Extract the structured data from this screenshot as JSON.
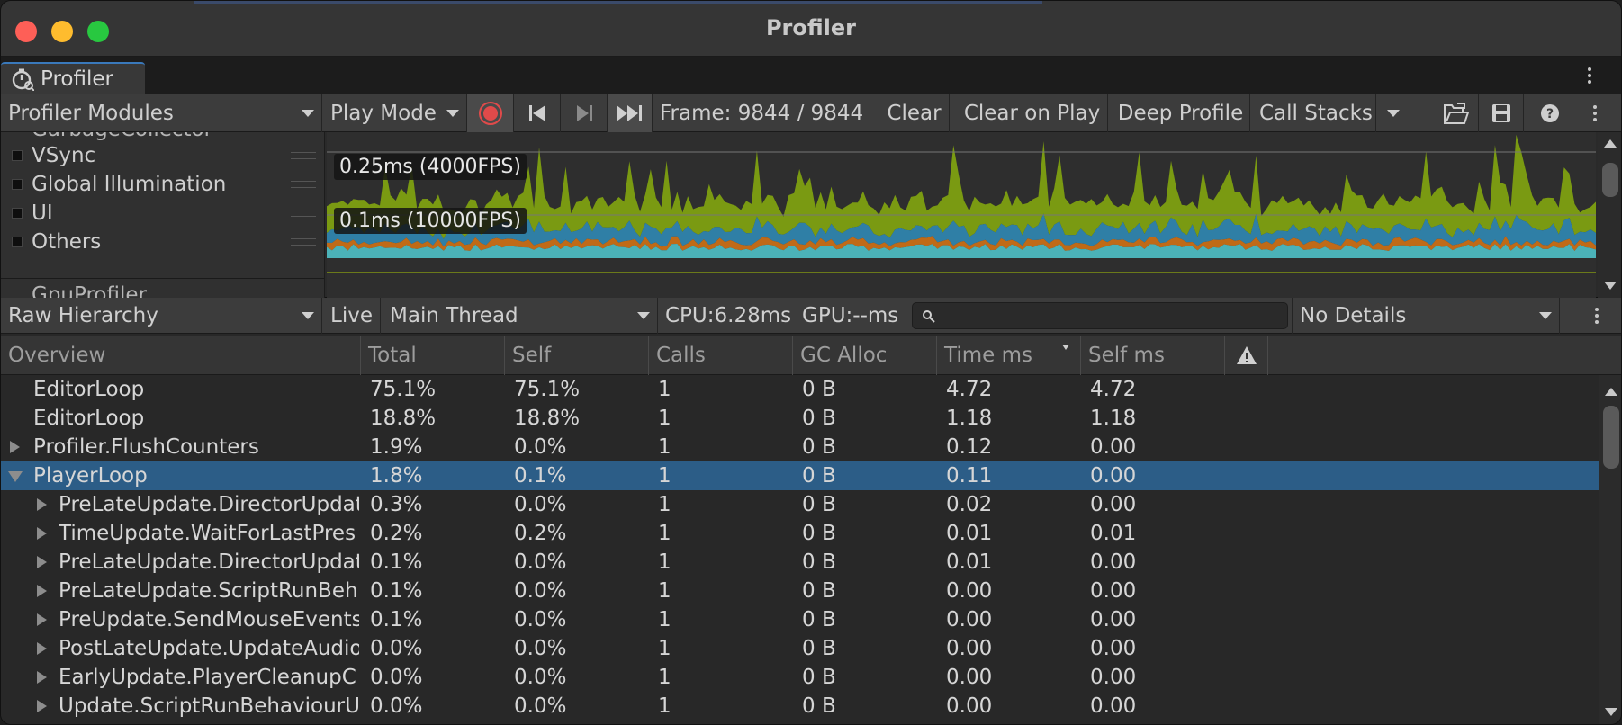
{
  "window": {
    "title": "Profiler"
  },
  "tab": {
    "label": "Profiler"
  },
  "toolbar": {
    "modules_label": "Profiler Modules",
    "mode_label": "Play Mode",
    "frame_label": "Frame: 9844 / 9844",
    "clear_label": "Clear",
    "clear_on_play_label": "Clear on Play",
    "deep_profile_label": "Deep Profile",
    "call_stacks_label": "Call Stacks"
  },
  "legend": {
    "cut_top": "GarbageCollector",
    "cut_bottom": "GpuProfiler",
    "items": [
      {
        "label": "VSync"
      },
      {
        "label": "Global Illumination"
      },
      {
        "label": "UI"
      },
      {
        "label": "Others"
      }
    ]
  },
  "graph": {
    "label_top": "0.25ms (4000FPS)",
    "label_mid": "0.1ms (10000FPS)",
    "colors": {
      "green": "#7a9a12",
      "blue": "#2f7fa6",
      "orange": "#c06a17",
      "teal": "#4bb2b8",
      "bg": "#2e2e2e"
    }
  },
  "toolbar2": {
    "view_label": "Raw Hierarchy",
    "live_label": "Live",
    "thread_label": "Main Thread",
    "cpu_label": "CPU:6.28ms",
    "gpu_label": "GPU:--ms",
    "search_placeholder": "",
    "details_label": "No Details"
  },
  "table": {
    "columns": [
      "Overview",
      "Total",
      "Self",
      "Calls",
      "GC Alloc",
      "Time ms",
      "Self ms"
    ],
    "rows": [
      {
        "name": "EditorLoop",
        "total": "75.1%",
        "self": "75.1%",
        "calls": "1",
        "gc": "0 B",
        "time": "4.72",
        "selfms": "4.72",
        "level": 0,
        "expander": "none",
        "selected": false
      },
      {
        "name": "EditorLoop",
        "total": "18.8%",
        "self": "18.8%",
        "calls": "1",
        "gc": "0 B",
        "time": "1.18",
        "selfms": "1.18",
        "level": 0,
        "expander": "none",
        "selected": false
      },
      {
        "name": "Profiler.FlushCounters",
        "total": "1.9%",
        "self": "0.0%",
        "calls": "1",
        "gc": "0 B",
        "time": "0.12",
        "selfms": "0.00",
        "level": 0,
        "expander": "collapsed",
        "selected": false
      },
      {
        "name": "PlayerLoop",
        "total": "1.8%",
        "self": "0.1%",
        "calls": "1",
        "gc": "0 B",
        "time": "0.11",
        "selfms": "0.00",
        "level": 0,
        "expander": "expanded",
        "selected": true
      },
      {
        "name": "PreLateUpdate.DirectorUpdat",
        "total": "0.3%",
        "self": "0.0%",
        "calls": "1",
        "gc": "0 B",
        "time": "0.02",
        "selfms": "0.00",
        "level": 1,
        "expander": "collapsed",
        "selected": false
      },
      {
        "name": "TimeUpdate.WaitForLastPres",
        "total": "0.2%",
        "self": "0.2%",
        "calls": "1",
        "gc": "0 B",
        "time": "0.01",
        "selfms": "0.01",
        "level": 1,
        "expander": "collapsed",
        "selected": false
      },
      {
        "name": "PreLateUpdate.DirectorUpdat",
        "total": "0.1%",
        "self": "0.0%",
        "calls": "1",
        "gc": "0 B",
        "time": "0.01",
        "selfms": "0.00",
        "level": 1,
        "expander": "collapsed",
        "selected": false
      },
      {
        "name": "PreLateUpdate.ScriptRunBeh",
        "total": "0.1%",
        "self": "0.0%",
        "calls": "1",
        "gc": "0 B",
        "time": "0.00",
        "selfms": "0.00",
        "level": 1,
        "expander": "collapsed",
        "selected": false
      },
      {
        "name": "PreUpdate.SendMouseEvents",
        "total": "0.1%",
        "self": "0.0%",
        "calls": "1",
        "gc": "0 B",
        "time": "0.00",
        "selfms": "0.00",
        "level": 1,
        "expander": "collapsed",
        "selected": false
      },
      {
        "name": "PostLateUpdate.UpdateAudio",
        "total": "0.0%",
        "self": "0.0%",
        "calls": "1",
        "gc": "0 B",
        "time": "0.00",
        "selfms": "0.00",
        "level": 1,
        "expander": "collapsed",
        "selected": false
      },
      {
        "name": "EarlyUpdate.PlayerCleanupC",
        "total": "0.0%",
        "self": "0.0%",
        "calls": "1",
        "gc": "0 B",
        "time": "0.00",
        "selfms": "0.00",
        "level": 1,
        "expander": "collapsed",
        "selected": false
      },
      {
        "name": "Update.ScriptRunBehaviourU",
        "total": "0.0%",
        "self": "0.0%",
        "calls": "1",
        "gc": "0 B",
        "time": "0.00",
        "selfms": "0.00",
        "level": 1,
        "expander": "collapsed",
        "selected": false
      }
    ]
  }
}
